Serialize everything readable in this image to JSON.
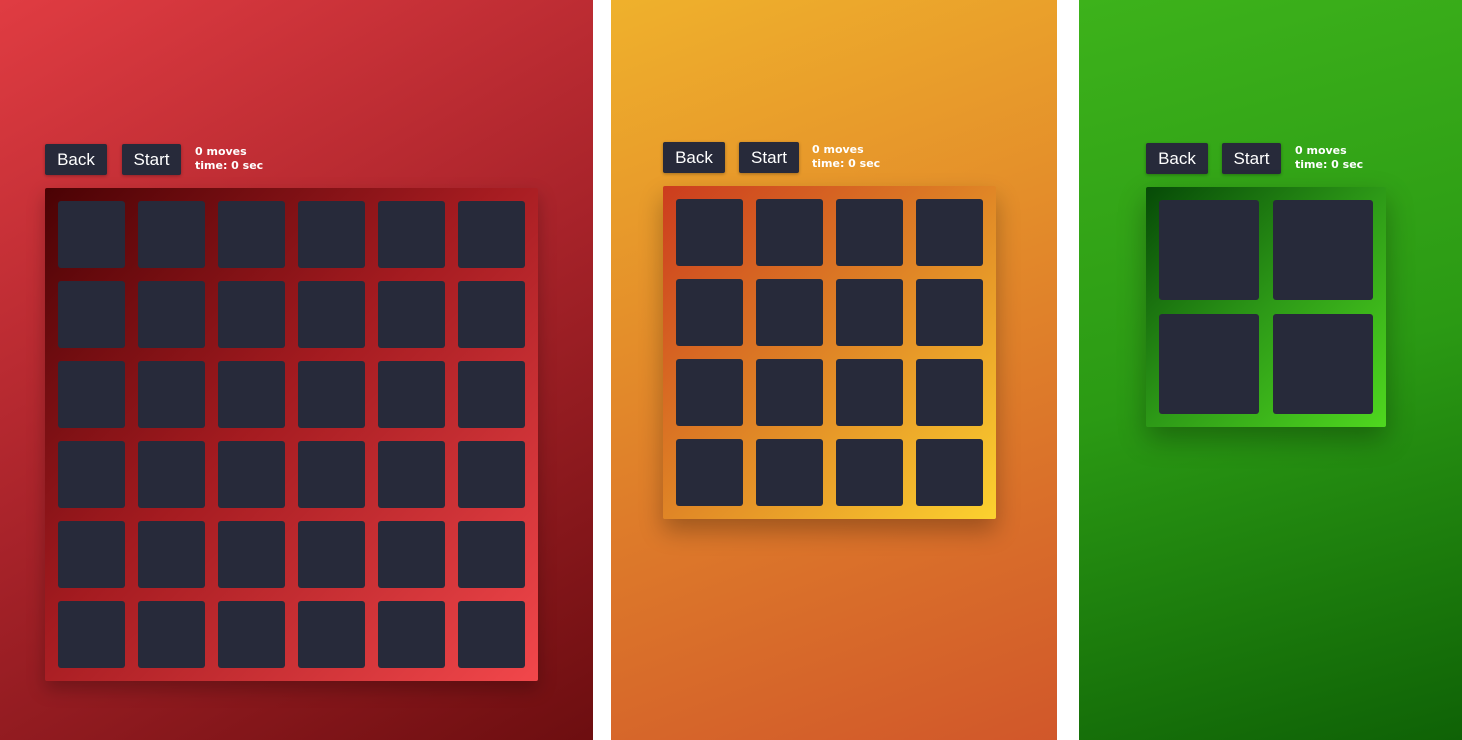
{
  "panels": [
    {
      "id": "red",
      "back_label": "Back",
      "start_label": "Start",
      "moves_text": "0 moves",
      "time_text": "time: 0 sec",
      "grid_size": 6,
      "colors": {
        "background": "#a8232a",
        "board": "#a41b20",
        "tile": "#272a3a"
      }
    },
    {
      "id": "orange",
      "back_label": "Back",
      "start_label": "Start",
      "moves_text": "0 moves",
      "time_text": "time: 0 sec",
      "grid_size": 4,
      "colors": {
        "background": "#e2882a",
        "board": "#dd7e25",
        "tile": "#272a3a"
      }
    },
    {
      "id": "green",
      "back_label": "Back",
      "start_label": "Start",
      "moves_text": "0 moves",
      "time_text": "time: 0 sec",
      "grid_size": 2,
      "colors": {
        "background": "#2b9a14",
        "board": "#2d9917",
        "tile": "#272a3a"
      }
    }
  ]
}
